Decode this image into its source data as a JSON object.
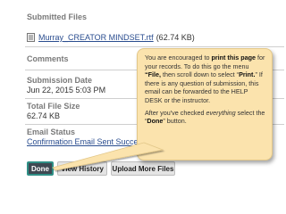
{
  "submission": {
    "files_label": "Submitted Files",
    "file_name": "Murray_CREATOR MINDSET.rtf",
    "file_size": "(62.74 KB)",
    "comments_label": "Comments",
    "date_label": "Submission Date",
    "date_value": "Jun 22, 2015 5:03 PM",
    "total_size_label": "Total File Size",
    "total_size_value": "62.74 KB",
    "email_status_label": "Email Status",
    "email_status_value": "Confirmation Email Sent Successfully"
  },
  "buttons": {
    "done": "Done",
    "view_history": "View History",
    "upload_more": "Upload More Files"
  },
  "callout": {
    "p1_a": "You are encouraged to ",
    "p1_b": "print this page",
    "p1_c": " for your records. To do this go the menu ",
    "p1_d": "“File,",
    "p1_e": " then scroll down to select “",
    "p1_f": "Print.",
    "p1_g": "” If there is any question of submission, this email can be forwarded to the HELP DESK or the instructor.",
    "p2_a": "After you've checked ",
    "p2_b": "everything",
    "p2_c": " select the “",
    "p2_d": "Done",
    "p2_e": "” button."
  },
  "icons": {
    "file": "rtf-file-icon",
    "arrow": "callout-arrow"
  },
  "colors": {
    "callout_bg": "#fbe3ad",
    "done_border": "#2f8f86",
    "link": "#2a4d8f"
  }
}
